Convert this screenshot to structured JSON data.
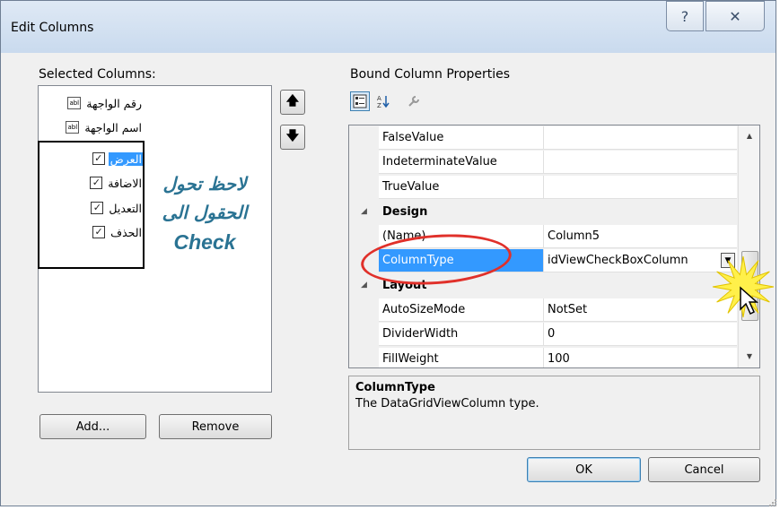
{
  "window": {
    "title": "Edit Columns",
    "help_glyph": "?",
    "close_glyph": "✕"
  },
  "left": {
    "selected_label": "Selected Columns:",
    "items": [
      {
        "label": "رقم الواجهة",
        "icon": "abl",
        "kind": "text"
      },
      {
        "label": "اسم الواجهة",
        "icon": "abl",
        "kind": "text"
      },
      {
        "label": "العرض",
        "icon": "checkbox",
        "kind": "check",
        "selected": true
      },
      {
        "label": "الاضافة",
        "icon": "checkbox",
        "kind": "check"
      },
      {
        "label": "التعديل",
        "icon": "checkbox",
        "kind": "check"
      },
      {
        "label": "الحذف",
        "icon": "checkbox",
        "kind": "check"
      }
    ],
    "annotation": [
      "لاحظ تحول",
      "الحقول الى",
      "Check"
    ],
    "add_button": "Add...",
    "remove_button": "Remove",
    "move_up_glyph": "🡅",
    "move_down_glyph": "🡇"
  },
  "right": {
    "properties_label": "Bound Column Properties",
    "grid": {
      "rows": [
        {
          "type": "prop",
          "name": "FalseValue",
          "value": ""
        },
        {
          "type": "prop",
          "name": "IndeterminateValue",
          "value": ""
        },
        {
          "type": "prop",
          "name": "TrueValue",
          "value": ""
        },
        {
          "type": "category",
          "name": "Design"
        },
        {
          "type": "prop",
          "name": "(Name)",
          "value": "Column5"
        },
        {
          "type": "prop",
          "name": "ColumnType",
          "value": "idViewCheckBoxColumn",
          "selected": true,
          "dropdown": true
        },
        {
          "type": "category",
          "name": "Layout"
        },
        {
          "type": "prop",
          "name": "AutoSizeMode",
          "value": "NotSet"
        },
        {
          "type": "prop",
          "name": "DividerWidth",
          "value": "0"
        },
        {
          "type": "prop",
          "name": "FillWeight",
          "value": "100"
        }
      ]
    },
    "description": {
      "title": "ColumnType",
      "text": "The DataGridViewColumn type."
    }
  },
  "footer": {
    "ok": "OK",
    "cancel": "Cancel"
  },
  "colors": {
    "selection": "#3399ff",
    "annotation_text": "#2a7393",
    "highlight_ellipse": "#e0302a",
    "burst": "#fff04a"
  }
}
